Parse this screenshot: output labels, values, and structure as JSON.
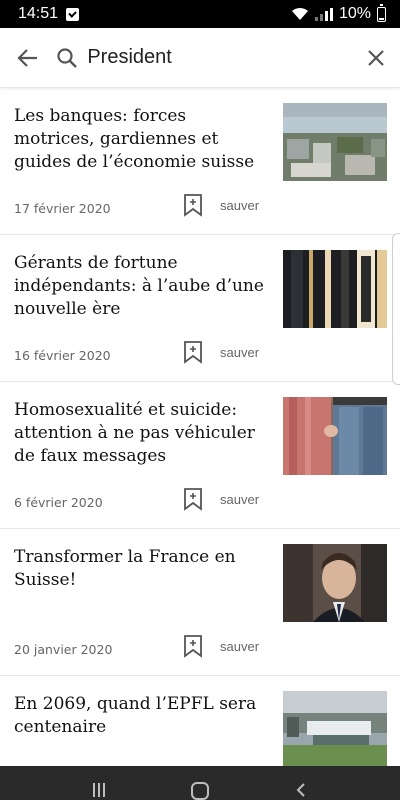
{
  "status_bar": {
    "time": "14:51",
    "battery": "10%"
  },
  "search": {
    "value": "President",
    "placeholder": ""
  },
  "articles": [
    {
      "title": "Les banques: forces motrices, gardiennes et guides de l’économie suisse",
      "date": "17 février 2020",
      "save_label": "sauver"
    },
    {
      "title": "Gérants de fortune indépendants: à l’aube d’une nouvelle ère",
      "date": "16 février 2020",
      "save_label": "sauver"
    },
    {
      "title": "Homosexualité et suicide: attention à ne pas véhiculer de faux messages",
      "date": "6 février 2020",
      "save_label": "sauver"
    },
    {
      "title": "Transformer la France en Suisse!",
      "date": "20 janvier 2020",
      "save_label": "sauver"
    },
    {
      "title": "En 2069, quand l’EPFL sera centenaire",
      "date": "",
      "save_label": ""
    }
  ],
  "colors": {
    "status_bar": "#000000",
    "nav_bar": "#2a2a2a",
    "text": "#111111",
    "meta": "#666666"
  },
  "icons": [
    "back-arrow-icon",
    "search-icon",
    "close-icon",
    "bookmark-icon",
    "wifi-icon",
    "signal-icon",
    "battery-icon"
  ]
}
